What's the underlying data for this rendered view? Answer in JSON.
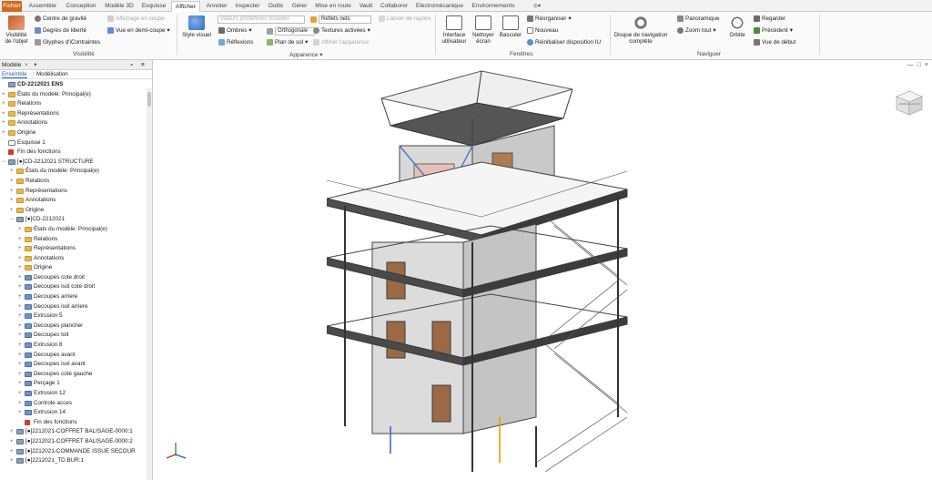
{
  "tabs": [
    "Fichier",
    "Assembler",
    "Conception",
    "Modèle 3D",
    "Esquisse",
    "Afficher",
    "Annoter",
    "Inspecter",
    "Outils",
    "Gérer",
    "Mise en route",
    "Vault",
    "Collaborer",
    "Electromécanique",
    "Environnements"
  ],
  "active_tab": "Afficher",
  "ribbon": {
    "visibilite_panel": {
      "title": "Visibilité",
      "big_button": "Visibilité de l'objet",
      "items": [
        "Centre de gravité",
        "Degrés de liberté",
        "Glyphes d'iContraintes",
        "Affichage en coupe",
        "Vue en demi-coupe"
      ]
    },
    "apparence_panel": {
      "title": "Apparence",
      "big_button": "Style visuel",
      "visual_style_dropdown": "Valeurs prédéfinies visuelles",
      "reflets": "Reflets nets",
      "lancer_rayons": "Lancer de rayons",
      "ombres": "Ombres",
      "orthogonale": "Orthogonale",
      "textures": "Textures activées",
      "reflexions": "Réflexions",
      "plan_sol": "Plan de sol",
      "affiner": "Affiner l'apparence"
    },
    "fenetres_panel": {
      "title": "Fenêtres",
      "interface": "Interface utilisateur",
      "nettoyer": "Nettoyer écran",
      "basculer": "Basculer",
      "reorganiser": "Réorganiser",
      "nouveau": "Nouveau",
      "reinit": "Réinitialiser disposition IU"
    },
    "navigateur_panel": {
      "title": "Naviguer",
      "disque": "Disque de navigation complète",
      "panoramique": "Panoramique",
      "zoom": "Zoom tout",
      "orbite": "Orbite",
      "regarder": "Regarder",
      "precedent": "Précédent",
      "vue_debut": "Vue de début"
    }
  },
  "browser": {
    "title": "Modèle",
    "add": "+",
    "tabs": [
      "Ensemble",
      "Modélisation"
    ],
    "active_tab": "Ensemble",
    "tree": [
      {
        "label": "CD-2212021 ENS",
        "icon": "part",
        "indent": 0,
        "exp": "",
        "bold": true
      },
      {
        "label": "États du modèle: Principal(e)",
        "icon": "folder",
        "indent": 0,
        "exp": "+"
      },
      {
        "label": "Relations",
        "icon": "folder",
        "indent": 0,
        "exp": "+"
      },
      {
        "label": "Représentations",
        "icon": "folder",
        "indent": 0,
        "exp": "+"
      },
      {
        "label": "Annotations",
        "icon": "folder",
        "indent": 0,
        "exp": "+"
      },
      {
        "label": "Origine",
        "icon": "folder",
        "indent": 0,
        "exp": "+"
      },
      {
        "label": "Esquisse 1",
        "icon": "sketch",
        "indent": 0,
        "exp": ""
      },
      {
        "label": "Fin des fonctions",
        "icon": "stop",
        "indent": 0,
        "exp": ""
      },
      {
        "label": "[●]CD-2212021 STRUCTURE",
        "icon": "part",
        "indent": 0,
        "exp": "−"
      },
      {
        "label": "États du modèle: Principal(e)",
        "icon": "folder",
        "indent": 1,
        "exp": "+"
      },
      {
        "label": "Relations",
        "icon": "folder",
        "indent": 1,
        "exp": "+"
      },
      {
        "label": "Représentations",
        "icon": "folder",
        "indent": 1,
        "exp": "+"
      },
      {
        "label": "Annotations",
        "icon": "folder",
        "indent": 1,
        "exp": "+"
      },
      {
        "label": "Origine",
        "icon": "folder",
        "indent": 1,
        "exp": "+"
      },
      {
        "label": "[●]CD-2212021",
        "icon": "part",
        "indent": 1,
        "exp": "−"
      },
      {
        "label": "États du modèle: Principal(e)",
        "icon": "folder",
        "indent": 2,
        "exp": "+"
      },
      {
        "label": "Relations",
        "icon": "folder",
        "indent": 2,
        "exp": "+"
      },
      {
        "label": "Représentations",
        "icon": "folder",
        "indent": 2,
        "exp": "+"
      },
      {
        "label": "Annotations",
        "icon": "folder",
        "indent": 2,
        "exp": "+"
      },
      {
        "label": "Origine",
        "icon": "folder",
        "indent": 2,
        "exp": "+"
      },
      {
        "label": "Decoupes cote droit",
        "icon": "feat",
        "indent": 2,
        "exp": "+"
      },
      {
        "label": "Decoupes isol cote droit",
        "icon": "feat",
        "indent": 2,
        "exp": "+"
      },
      {
        "label": "Decoupes arriere",
        "icon": "feat",
        "indent": 2,
        "exp": "+"
      },
      {
        "label": "Decoupes isol arriere",
        "icon": "feat",
        "indent": 2,
        "exp": "+"
      },
      {
        "label": "Extrusion 5",
        "icon": "feat",
        "indent": 2,
        "exp": "+"
      },
      {
        "label": "Decoupes plancher",
        "icon": "feat",
        "indent": 2,
        "exp": "+"
      },
      {
        "label": "Decoupes toit",
        "icon": "feat",
        "indent": 2,
        "exp": "+"
      },
      {
        "label": "Extrusion 8",
        "icon": "feat",
        "indent": 2,
        "exp": "+"
      },
      {
        "label": "Decoupes avant",
        "icon": "feat",
        "indent": 2,
        "exp": "+"
      },
      {
        "label": "Decoupes isol avant",
        "icon": "feat",
        "indent": 2,
        "exp": "+"
      },
      {
        "label": "Decoupes cote gauche",
        "icon": "feat",
        "indent": 2,
        "exp": "+"
      },
      {
        "label": "Perçage 1",
        "icon": "feat",
        "indent": 2,
        "exp": "+"
      },
      {
        "label": "Extrusion 12",
        "icon": "feat",
        "indent": 2,
        "exp": "+"
      },
      {
        "label": "Controle acces",
        "icon": "feat",
        "indent": 2,
        "exp": "+"
      },
      {
        "label": "Extrusion 14",
        "icon": "feat",
        "indent": 2,
        "exp": "+"
      },
      {
        "label": "Fin des fonctions",
        "icon": "stop",
        "indent": 2,
        "exp": ""
      },
      {
        "label": "[●]2212021-COFFRET BALISAGE-0000:1",
        "icon": "part",
        "indent": 1,
        "exp": "+"
      },
      {
        "label": "[●]2212021-COFFRET BALISAGE-0000:2",
        "icon": "part",
        "indent": 1,
        "exp": "+"
      },
      {
        "label": "[●]2212021-COMMANDE ISSUE SECOUR",
        "icon": "part",
        "indent": 1,
        "exp": "+"
      },
      {
        "label": "[●]2212021_TD BUR:1",
        "icon": "part",
        "indent": 1,
        "exp": "+"
      }
    ]
  },
  "viewport": {
    "viewcube_label": "ARRIÈRE GAUCHE",
    "window_buttons": [
      "—",
      "□",
      "×"
    ]
  },
  "colors": {
    "file_tab": "#d4691e",
    "accent": "#1f5fbf",
    "structure": "#4a4a4a"
  }
}
